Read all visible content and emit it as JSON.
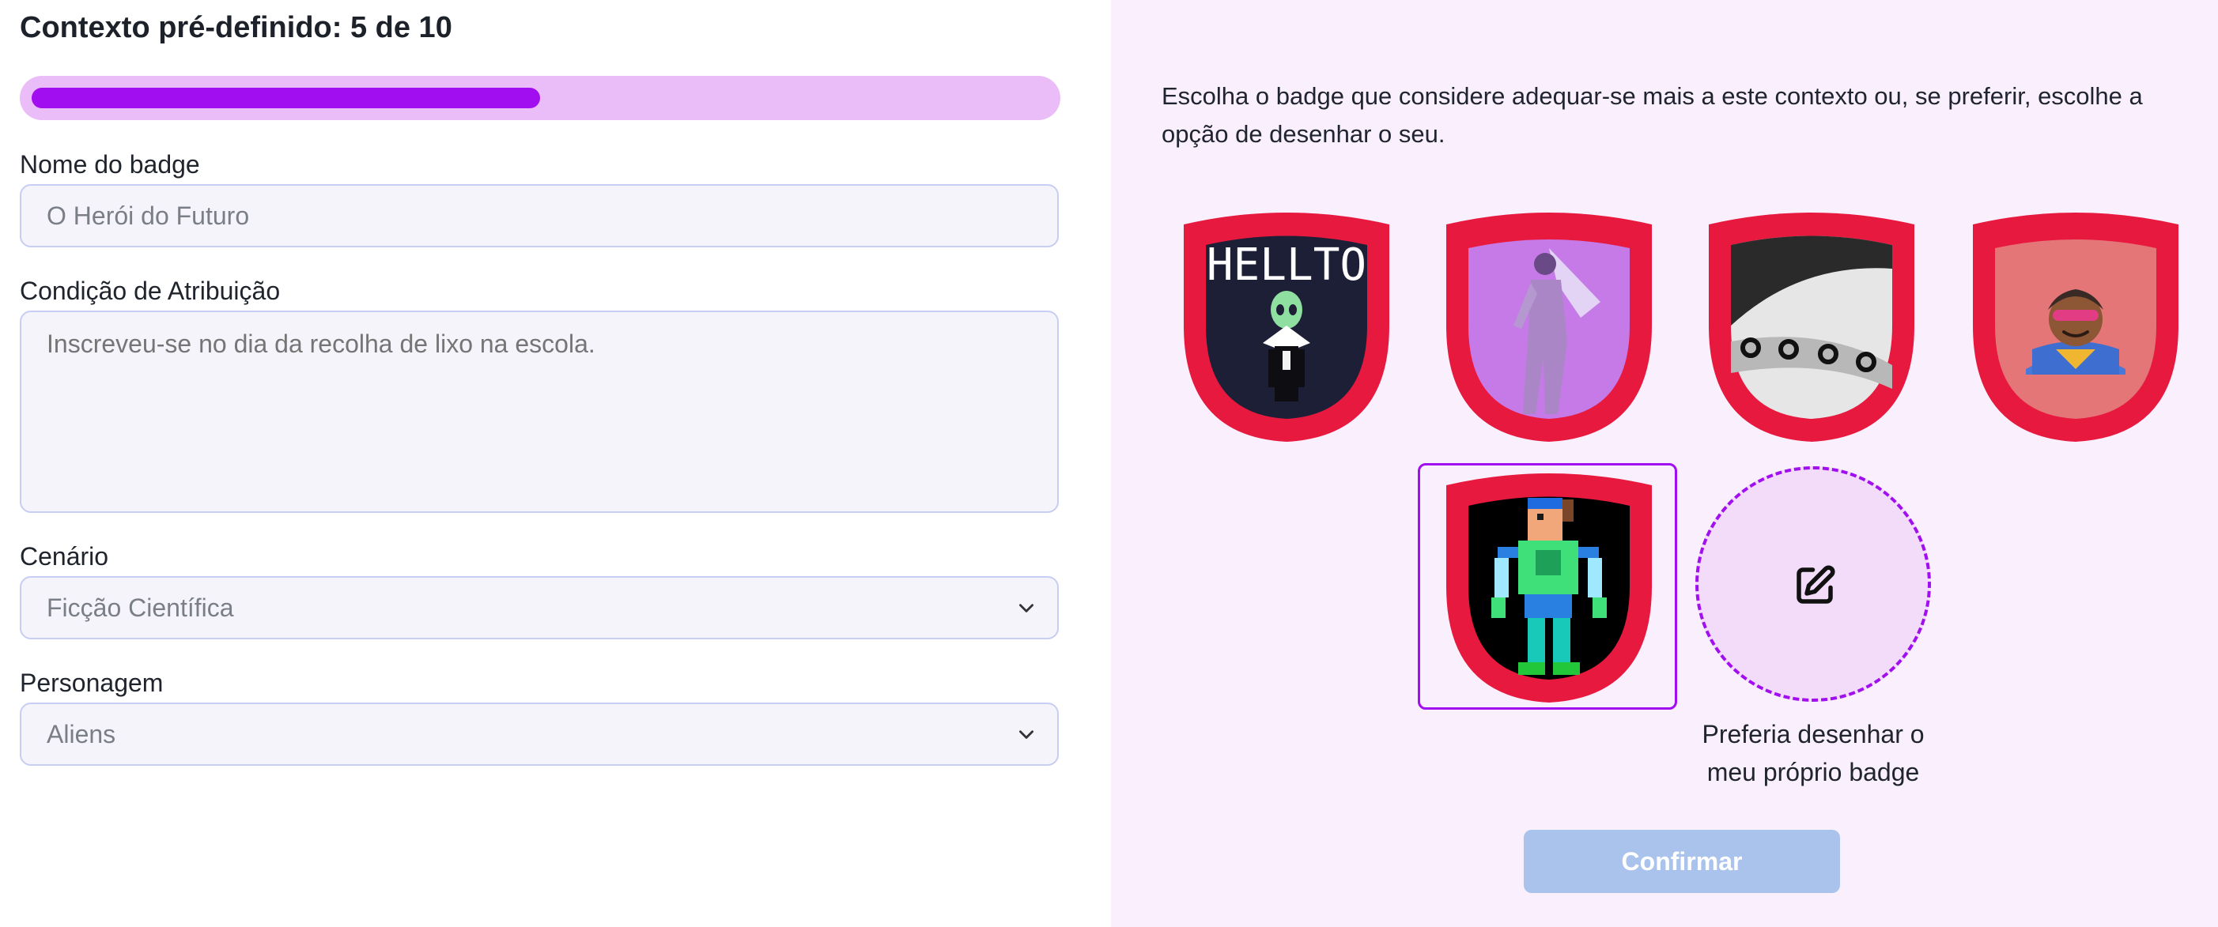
{
  "form": {
    "title": "Contexto pré-definido: 5 de 10",
    "progress": {
      "current": 5,
      "total": 10
    },
    "name_label": "Nome do badge",
    "name_placeholder": "O Herói do Futuro",
    "condition_label": "Condição de Atribuição",
    "condition_placeholder": "Inscreveu-se no dia da recolha de lixo na escola.",
    "scenario_label": "Cenário",
    "scenario_value": "Ficção Científica",
    "character_label": "Personagem",
    "character_value": "Aliens"
  },
  "chooser": {
    "intro": "Escolha o badge que considere adequar-se mais a este contexto ou, se preferir, escolhe a opção de desenhar o seu.",
    "badge1_text": "HELLTO",
    "selected_badge_index": 4,
    "draw_option": {
      "line1": "Preferia desenhar o",
      "line2": "meu próprio badge",
      "icon": "edit-icon"
    },
    "confirm_label": "Confirmar"
  },
  "colors": {
    "accent": "#a10ef0",
    "progress_track": "#ebbdf8",
    "badge_frame": "#e8193f",
    "right_panel_bg": "#f9effd",
    "confirm_disabled": "#a9c3ec"
  }
}
